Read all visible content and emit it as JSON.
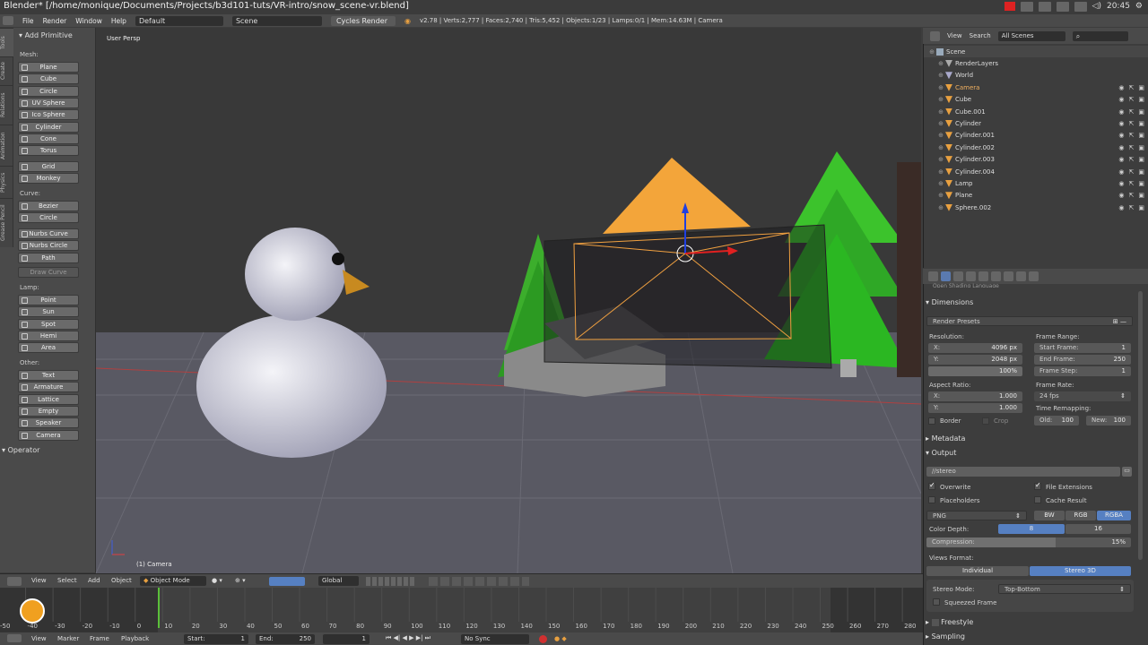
{
  "titlebar": {
    "title": "Blender* [/home/monique/Documents/Projects/b3d101-tuts/VR-intro/snow_scene-vr.blend]",
    "clock": "20:45"
  },
  "mainmenu": {
    "items": [
      "File",
      "Render",
      "Window",
      "Help"
    ],
    "layout": "Default",
    "scene": "Scene",
    "engine": "Cycles Render",
    "stats": "v2.78 | Verts:2,777 | Faces:2,740 | Tris:5,452 | Objects:1/23 | Lamps:0/1 | Mem:14.63M | Camera"
  },
  "toolshelf": {
    "panel_title": "Add Primitive",
    "tabs": [
      "Tools",
      "Create",
      "Relations",
      "Animation",
      "Physics",
      "Grease Pencil"
    ],
    "mesh_label": "Mesh:",
    "mesh": [
      "Plane",
      "Cube",
      "Circle",
      "UV Sphere",
      "Ico Sphere",
      "Cylinder",
      "Cone",
      "Torus"
    ],
    "mesh2": [
      "Grid",
      "Monkey"
    ],
    "curve_label": "Curve:",
    "curve": [
      "Bezier",
      "Circle"
    ],
    "curve2": [
      "Nurbs Curve",
      "Nurbs Circle",
      "Path"
    ],
    "draw_curve": "Draw Curve",
    "lamp_label": "Lamp:",
    "lamp": [
      "Point",
      "Sun",
      "Spot",
      "Hemi",
      "Area"
    ],
    "other_label": "Other:",
    "other": [
      "Text",
      "Armature",
      "Lattice",
      "Empty",
      "Speaker",
      "Camera"
    ],
    "operator": "Operator"
  },
  "viewport": {
    "view_name": "User Persp",
    "object_name": "(1) Camera"
  },
  "outliner": {
    "view": "View",
    "search": "Search",
    "filter": "All Scenes",
    "items": [
      {
        "name": "Scene",
        "indent": 0,
        "color": "#9ab"
      },
      {
        "name": "RenderLayers",
        "indent": 1,
        "color": "#aaa"
      },
      {
        "name": "World",
        "indent": 1,
        "color": "#aac"
      },
      {
        "name": "Camera",
        "indent": 1,
        "color": "#e8a040"
      },
      {
        "name": "Cube",
        "indent": 1,
        "color": "#e8a040"
      },
      {
        "name": "Cube.001",
        "indent": 1,
        "color": "#e8a040"
      },
      {
        "name": "Cylinder",
        "indent": 1,
        "color": "#e8a040"
      },
      {
        "name": "Cylinder.001",
        "indent": 1,
        "color": "#e8a040"
      },
      {
        "name": "Cylinder.002",
        "indent": 1,
        "color": "#e8a040"
      },
      {
        "name": "Cylinder.003",
        "indent": 1,
        "color": "#e8a040"
      },
      {
        "name": "Cylinder.004",
        "indent": 1,
        "color": "#e8a040"
      },
      {
        "name": "Lamp",
        "indent": 1,
        "color": "#e8a040"
      },
      {
        "name": "Plane",
        "indent": 1,
        "color": "#e8a040"
      },
      {
        "name": "Sphere.002",
        "indent": 1,
        "color": "#e8a040"
      }
    ]
  },
  "props": {
    "cut_section": "Open Shading Language",
    "dimensions": "Dimensions",
    "render_presets": "Render Presets",
    "resolution": "Resolution:",
    "res_x_label": "X:",
    "res_x": "4096 px",
    "res_y_label": "Y:",
    "res_y": "2048 px",
    "res_pct": "100%",
    "frame_range": "Frame Range:",
    "start_label": "Start Frame:",
    "start": "1",
    "end_label": "End Frame:",
    "end": "250",
    "step_label": "Frame Step:",
    "step": "1",
    "aspect": "Aspect Ratio:",
    "asp_x_label": "X:",
    "asp_x": "1.000",
    "asp_y_label": "Y:",
    "asp_y": "1.000",
    "frame_rate": "Frame Rate:",
    "fps": "24 fps",
    "time_remap": "Time Remapping:",
    "old_label": "Old:",
    "old": "100",
    "new_label": "New:",
    "new": "100",
    "border": "Border",
    "crop": "Crop",
    "metadata": "Metadata",
    "output": "Output",
    "path": "//stereo",
    "overwrite": "Overwrite",
    "file_ext": "File Extensions",
    "placeholders": "Placeholders",
    "cache_result": "Cache Result",
    "format": "PNG",
    "bw": "BW",
    "rgb": "RGB",
    "rgba": "RGBA",
    "color_depth": "Color Depth:",
    "depth8": "8",
    "depth16": "16",
    "compression": "Compression:",
    "compression_val": "15%",
    "compression_fraction": 0.15,
    "views_format": "Views Format:",
    "individual": "Individual",
    "stereo3d": "Stereo 3D",
    "stereo_mode_label": "Stereo Mode:",
    "stereo_mode": "Top-Bottom",
    "squeezed": "Squeezed Frame",
    "freestyle": "Freestyle",
    "sampling": "Sampling"
  },
  "vp_header": {
    "items": [
      "View",
      "Select",
      "Add",
      "Object"
    ],
    "mode": "Object Mode",
    "orientation": "Global"
  },
  "timeline": {
    "ticks": [
      "-50",
      "-40",
      "-30",
      "-20",
      "-10",
      "0",
      "10",
      "20",
      "30",
      "40",
      "50",
      "60",
      "70",
      "80",
      "90",
      "100",
      "110",
      "120",
      "130",
      "140",
      "150",
      "160",
      "170",
      "180",
      "190",
      "200",
      "210",
      "220",
      "230",
      "240",
      "250",
      "260",
      "270",
      "280"
    ]
  },
  "tl_header": {
    "items": [
      "View",
      "Marker",
      "Frame",
      "Playback"
    ],
    "start_label": "Start:",
    "start": "1",
    "end_label": "End:",
    "end": "250",
    "current": "1",
    "sync": "No Sync"
  }
}
